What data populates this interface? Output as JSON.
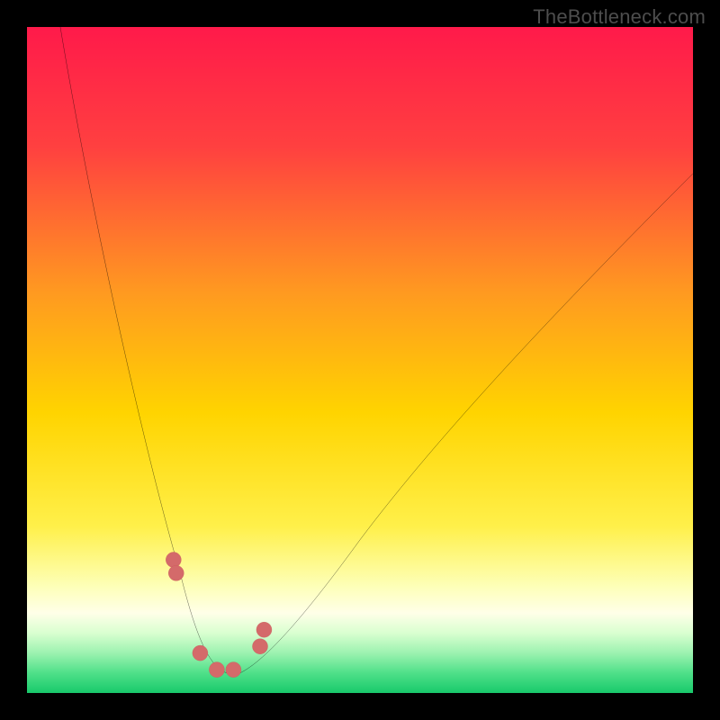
{
  "watermark": "TheBottleneck.com",
  "colors": {
    "frame": "#000000",
    "gradient_top": "#ff1a4a",
    "gradient_mid_upper": "#ff7a2a",
    "gradient_mid": "#ffd400",
    "gradient_mid_lower": "#fff59a",
    "gradient_band_pale": "#ffffe0",
    "gradient_lower_green1": "#c8f7c5",
    "gradient_lower_green2": "#66e28a",
    "gradient_bottom": "#18c96b",
    "curve_stroke": "#000000",
    "marker_fill": "#d46a6a"
  },
  "chart_data": {
    "type": "line",
    "title": "",
    "xlabel": "",
    "ylabel": "",
    "xlim": [
      0,
      100
    ],
    "ylim": [
      100,
      0
    ],
    "note": "axes_not_labeled_in_source_image; values are visual estimates on a 0-100 scale",
    "series": [
      {
        "name": "bottleneck-curve",
        "x": [
          5,
          8,
          11,
          14,
          17,
          20,
          23,
          25,
          27,
          29,
          30,
          32,
          35,
          40,
          47,
          55,
          63,
          72,
          82,
          92,
          100
        ],
        "y": [
          0,
          18,
          34,
          48,
          60,
          70,
          79,
          85,
          90,
          94,
          97,
          97,
          94,
          88,
          80,
          70,
          60,
          50,
          40,
          30,
          22
        ]
      },
      {
        "name": "markers",
        "x": [
          22.0,
          22.4,
          26.0,
          28.5,
          31.0,
          35.0,
          35.6
        ],
        "y": [
          80.0,
          82.0,
          94.0,
          96.5,
          96.5,
          93.0,
          90.5
        ]
      }
    ]
  }
}
